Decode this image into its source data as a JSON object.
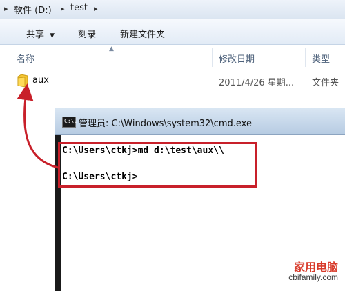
{
  "address": {
    "crumbs": [
      "软件 (D:)",
      "test"
    ],
    "separator": "▸"
  },
  "toolbar": {
    "share_label": "共享",
    "burn_label": "刻录",
    "new_folder_label": "新建文件夹"
  },
  "columns": {
    "name": "名称",
    "modified": "修改日期",
    "type": "类型"
  },
  "files": [
    {
      "name": "aux",
      "modified": "2011/4/26 星期...",
      "type": "文件夹",
      "icon": "folder-icon"
    }
  ],
  "cmd": {
    "title": "管理员: C:\\Windows\\system32\\cmd.exe",
    "icon_text": "C:\\.",
    "lines": [
      "C:\\Users\\ctkj>md d:\\test\\aux\\\\",
      "C:\\Users\\ctkj>"
    ]
  },
  "watermark": {
    "brand": "家用电脑",
    "url": "cbifamily.com"
  },
  "colors": {
    "highlight": "#c8202a",
    "arrow": "#c8202a"
  }
}
